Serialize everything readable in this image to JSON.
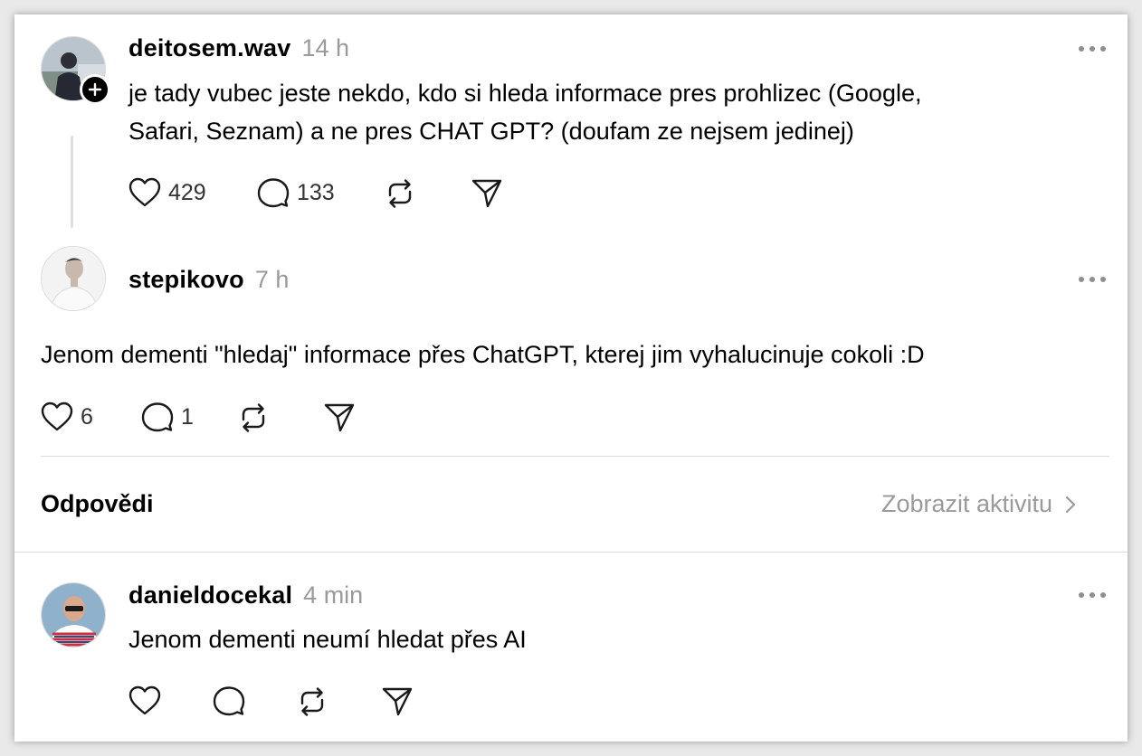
{
  "post": {
    "username": "deitosem.wav",
    "time": "14 h",
    "text_line1": "je tady vubec jeste nekdo, kdo si hleda informace pres prohlizec (Google,",
    "text_line2": "Safari, Seznam) a ne pres CHAT GPT? (doufam ze nejsem jedinej)",
    "likes": "429",
    "replies": "133",
    "avatar": "profile-photo"
  },
  "reply1": {
    "username": "stepikovo",
    "time": "7 h",
    "text": "Jenom dementi \"hledaj\" informace přes ChatGPT, kterej jim vyhalucinuje cokoli :D",
    "likes": "6",
    "replies": "1",
    "avatar": "profile-photo"
  },
  "section": {
    "title": "Odpovědi",
    "activity_label": "Zobrazit aktivitu"
  },
  "reply2": {
    "username": "danieldocekal",
    "time": "4 min",
    "text": "Jenom dementi neumí hledat přes AI",
    "avatar": "profile-photo"
  },
  "icons": [
    "heart-icon",
    "comment-icon",
    "repost-icon",
    "share-icon",
    "more-icon",
    "chevron-right-icon",
    "plus-icon"
  ],
  "colors": {
    "muted": "#9a9a9a",
    "text": "#000000",
    "divider": "#dcdcdc"
  }
}
